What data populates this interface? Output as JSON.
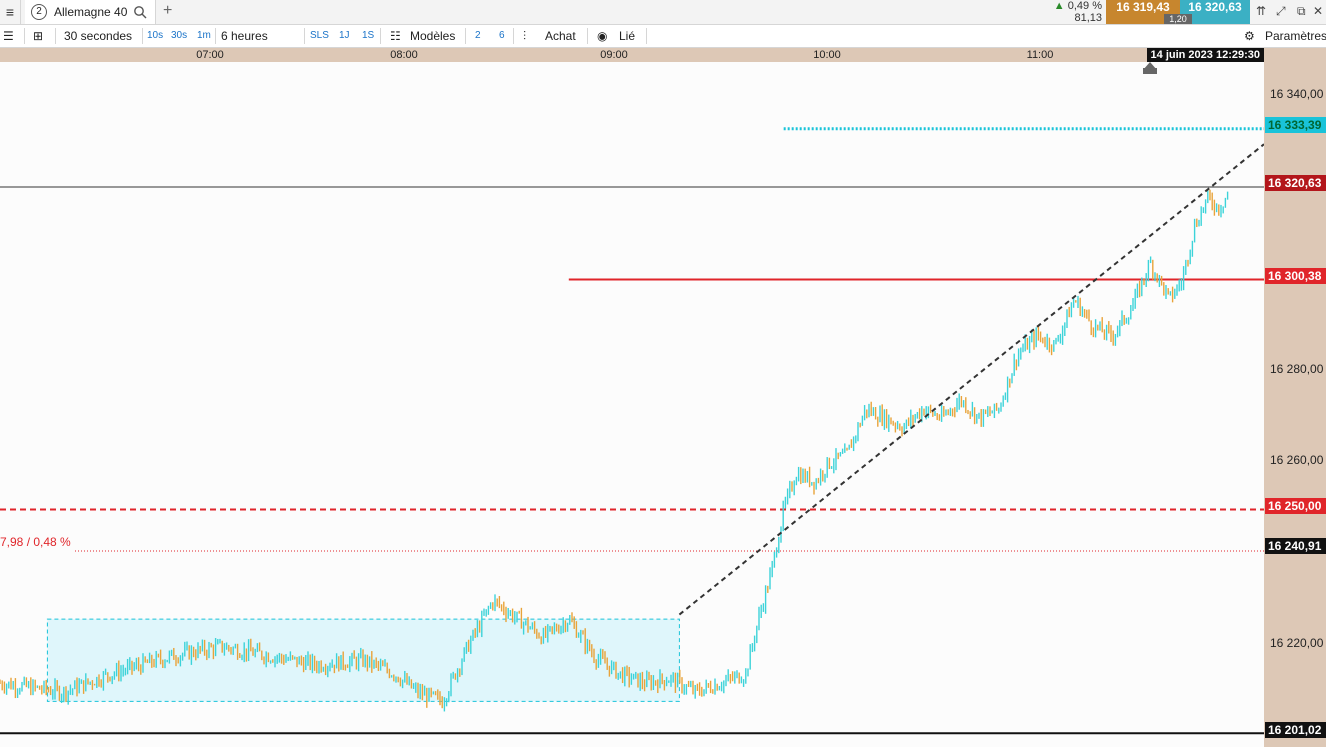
{
  "tabbar": {
    "tab_number": "2",
    "tab_label": "Allemagne 40",
    "add_tab": "+",
    "change_pct": "0,49 %",
    "change_pts": "81,13",
    "bid": "16 319,43",
    "ask": "16 320,63",
    "spread": "1,20"
  },
  "toolbar": {
    "interval": "30 secondes",
    "quick_intervals": [
      "10s",
      "30s",
      "1m"
    ],
    "period": "6 heures",
    "quick_periods": [
      "SLS",
      "1J",
      "1S"
    ],
    "models": "Modèles",
    "chart_count_a": "2",
    "chart_count_b": "6",
    "buy": "Achat",
    "linked": "Lié",
    "settings": "Paramètres"
  },
  "time_axis": {
    "labels": [
      "07:00",
      "08:00",
      "09:00",
      "10:00",
      "11:00"
    ],
    "cursor_time": "14 juin 2023 12:29:30"
  },
  "price_axis": {
    "labels": [
      "16 340,00",
      "16 280,00",
      "16 260,00",
      "16 220,00"
    ],
    "tags": {
      "high": "16 333,39",
      "last": "16 320,63",
      "resistance": "16 300,38",
      "support": "16 250,00",
      "close_ref": "16 240,91",
      "low": "16 201,02"
    }
  },
  "variation_label": "7,98 / 0,48 %",
  "colors": {
    "up_candle": "#3cd3d9",
    "down_candle": "#e8a33a",
    "resistance_line": "#e0252a",
    "high_line": "#19c3d9",
    "trendline": "#333333",
    "range_box": "#dff6fb",
    "axis_bg": "#ddc8b6"
  },
  "chart_data": {
    "type": "candlestick",
    "instrument": "Allemagne 40",
    "interval": "30 secondes",
    "ylim": [
      16198,
      16348
    ],
    "x_range": [
      "06:00",
      "12:30"
    ],
    "path": [
      [
        "06:00",
        16212
      ],
      [
        "06:20",
        16210
      ],
      [
        "06:35",
        16214
      ],
      [
        "06:55",
        16218
      ],
      [
        "07:10",
        16220
      ],
      [
        "07:25",
        16218
      ],
      [
        "07:40",
        16216
      ],
      [
        "07:55",
        16217
      ],
      [
        "08:05",
        16214
      ],
      [
        "08:12",
        16210
      ],
      [
        "08:20",
        16208
      ],
      [
        "08:28",
        16220
      ],
      [
        "08:36",
        16230
      ],
      [
        "08:44",
        16226
      ],
      [
        "08:52",
        16222
      ],
      [
        "09:00",
        16226
      ],
      [
        "09:08",
        16218
      ],
      [
        "09:16",
        16214
      ],
      [
        "09:24",
        16212
      ],
      [
        "09:32",
        16213
      ],
      [
        "09:40",
        16210
      ],
      [
        "09:48",
        16212
      ],
      [
        "09:56",
        16214
      ],
      [
        "10:00",
        16226
      ],
      [
        "10:04",
        16236
      ],
      [
        "10:08",
        16250
      ],
      [
        "10:12",
        16258
      ],
      [
        "10:18",
        16256
      ],
      [
        "10:22",
        16260
      ],
      [
        "10:28",
        16262
      ],
      [
        "10:34",
        16272
      ],
      [
        "10:40",
        16270
      ],
      [
        "10:46",
        16268
      ],
      [
        "10:52",
        16272
      ],
      [
        "10:58",
        16270
      ],
      [
        "11:04",
        16274
      ],
      [
        "11:10",
        16270
      ],
      [
        "11:16",
        16272
      ],
      [
        "11:22",
        16284
      ],
      [
        "11:28",
        16288
      ],
      [
        "11:34",
        16286
      ],
      [
        "11:40",
        16296
      ],
      [
        "11:46",
        16290
      ],
      [
        "11:52",
        16288
      ],
      [
        "11:58",
        16294
      ],
      [
        "12:04",
        16304
      ],
      [
        "12:10",
        16296
      ],
      [
        "12:14",
        16300
      ],
      [
        "12:18",
        16312
      ],
      [
        "12:22",
        16318
      ],
      [
        "12:26",
        16316
      ],
      [
        "12:29",
        16320
      ]
    ],
    "range_box": {
      "x": [
        "06:15",
        "09:35"
      ],
      "y": [
        16208,
        16226
      ]
    },
    "trendline": {
      "x": [
        "09:35",
        "12:40"
      ],
      "y": [
        16227,
        16330
      ]
    }
  }
}
